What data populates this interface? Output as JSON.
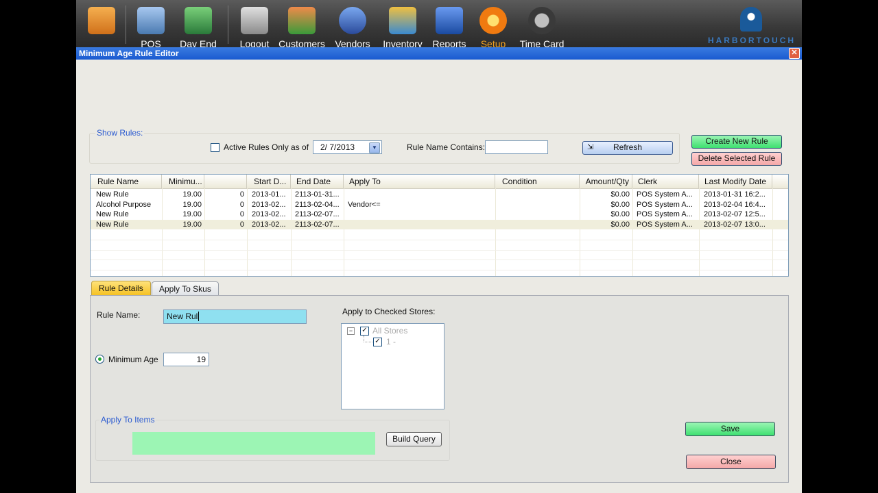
{
  "toolbar": {
    "items": [
      {
        "label": "",
        "icon": "home-icon",
        "color": "#e88a2a"
      },
      {
        "label": "POS",
        "icon": "pos-terminal-icon",
        "color": "#6a9ad0"
      },
      {
        "label": "Day End",
        "icon": "day-end-icon",
        "color": "#3a9a4a"
      },
      {
        "label": "Logout",
        "icon": "padlock-icon",
        "color": "#a8a8a8"
      },
      {
        "label": "Customers",
        "icon": "customers-icon",
        "color": "#e85a2a"
      },
      {
        "label": "Vendors",
        "icon": "vendor-icon",
        "color": "#3a6ac0"
      },
      {
        "label": "Inventory",
        "icon": "inventory-boxes-icon",
        "color": "#e8b020"
      },
      {
        "label": "Reports",
        "icon": "reports-icon",
        "color": "#2a6ad0"
      },
      {
        "label": "Setup",
        "icon": "gear-icon",
        "color": "#f07a10"
      },
      {
        "label": "Time Card",
        "icon": "clock-icon",
        "color": "#707070"
      }
    ],
    "logo_text": "HARBORTOUCH"
  },
  "window": {
    "title": "Minimum Age Rule Editor",
    "close_glyph": "✕"
  },
  "show_rules": {
    "group_title": "Show Rules:",
    "active_only_label": "Active Rules Only as of",
    "active_only_checked": false,
    "date_value": "2/ 7/2013",
    "name_contains_label": "Rule Name Contains:",
    "name_contains_value": "",
    "refresh_label": "Refresh"
  },
  "actions": {
    "create_label": "Create New Rule",
    "delete_label": "Delete Selected Rule"
  },
  "grid": {
    "columns": [
      "Rule Name",
      "Minimu...",
      "",
      "Start D...",
      "End Date",
      "Apply To",
      "Condition",
      "Amount/Qty",
      "Clerk",
      "Last Modify Date"
    ],
    "rows": [
      [
        "New Rule",
        "19.00",
        "0",
        "2013-01...",
        "2113-01-31...",
        "",
        "",
        "$0.00",
        "POS System A...",
        "2013-01-31 16:2..."
      ],
      [
        "Alcohol Purpose",
        "19.00",
        "0",
        "2013-02...",
        "2113-02-04...",
        "Vendor<=",
        "",
        "$0.00",
        "POS System A...",
        "2013-02-04 16:4..."
      ],
      [
        "New Rule",
        "19.00",
        "0",
        "2013-02...",
        "2113-02-07...",
        "",
        "",
        "$0.00",
        "POS System A...",
        "2013-02-07 12:5..."
      ],
      [
        "New Rule",
        "19.00",
        "0",
        "2013-02...",
        "2113-02-07...",
        "",
        "",
        "$0.00",
        "POS System A...",
        "2013-02-07 13:0..."
      ]
    ],
    "selected_row": 3
  },
  "tabs": [
    {
      "label": "Rule Details",
      "active": true
    },
    {
      "label": "Apply To Skus",
      "active": false
    }
  ],
  "details": {
    "rule_name_label": "Rule Name:",
    "rule_name_value": "New Rul",
    "min_age_label": "Minimum Age",
    "min_age_value": "19",
    "stores_label": "Apply to Checked Stores:",
    "stores_tree": [
      {
        "label": "All Stores",
        "checked": true,
        "expander": "−"
      },
      {
        "label": "1 -",
        "checked": true
      }
    ],
    "apply_items_title": "Apply To Items",
    "build_query_label": "Build Query",
    "save_label": "Save",
    "close_label": "Close"
  },
  "colors": {
    "titlebar": "#1a5ad0",
    "save_button": "#3ee070",
    "close_button": "#f4a8a8",
    "rule_name_highlight": "#8fe0f0",
    "apply_items_box": "#9cf5b4",
    "active_tab": "#f5c020",
    "group_title": "#2a5ad0"
  }
}
